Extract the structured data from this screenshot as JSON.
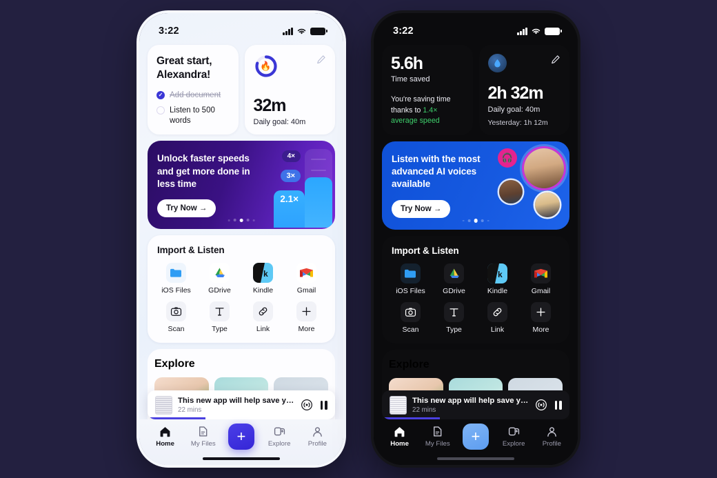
{
  "background_color": "#232040",
  "phones": [
    {
      "theme": "light",
      "status": {
        "time": "3:22",
        "signal_icon": "cellular-bars-icon",
        "wifi_icon": "wifi-icon",
        "battery_icon": "battery-icon"
      },
      "greeting": {
        "title": "Great start,\nAlexandra!",
        "todos": [
          {
            "label": "Add document",
            "done": true
          },
          {
            "label": "Listen to 500 words",
            "done": false
          }
        ]
      },
      "stats": {
        "edit_icon": "pencil-icon",
        "ring_percent": 80,
        "ring_color": "#3b37d6",
        "value": "32m",
        "sub": "Daily goal: 40m"
      },
      "promo": {
        "headline": "Unlock faster speeds and get more done in less time",
        "cta": "Try Now →",
        "dots": 5,
        "active_dot": 2,
        "chips": [
          "4×",
          "3×",
          "2.1×"
        ]
      },
      "import": {
        "title": "Import & Listen",
        "items": [
          {
            "label": "iOS Files",
            "icon": "ios-files-icon"
          },
          {
            "label": "GDrive",
            "icon": "google-drive-icon"
          },
          {
            "label": "Kindle",
            "icon": "kindle-icon"
          },
          {
            "label": "Gmail",
            "icon": "gmail-icon"
          },
          {
            "label": "Scan",
            "icon": "camera-icon"
          },
          {
            "label": "Type",
            "icon": "text-type-icon"
          },
          {
            "label": "Link",
            "icon": "link-icon"
          },
          {
            "label": "More",
            "icon": "plus-icon"
          }
        ]
      },
      "explore": {
        "title": "Explore"
      },
      "player": {
        "title": "This new app will help save yo...",
        "time": "22 mins",
        "cast_icon": "airplay-icon",
        "pause_icon": "pause-icon",
        "progress": 31
      },
      "nav": [
        {
          "label": "Home",
          "icon": "home-icon",
          "active": true
        },
        {
          "label": "My Files",
          "icon": "file-icon",
          "active": false
        },
        {
          "label": "",
          "icon": "plus-fab-icon",
          "active": false
        },
        {
          "label": "Explore",
          "icon": "explore-cards-icon",
          "active": false
        },
        {
          "label": "Profile",
          "icon": "person-icon",
          "active": false
        }
      ]
    },
    {
      "theme": "dark",
      "status": {
        "time": "3:22",
        "signal_icon": "cellular-bars-icon",
        "wifi_icon": "wifi-icon",
        "battery_icon": "battery-icon"
      },
      "time_saved": {
        "value": "5.6h",
        "label": "Time saved",
        "note_prefix": "You're saving time thanks to ",
        "note_highlight": "1.4× average speed"
      },
      "stats": {
        "edit_icon": "pencil-icon",
        "badge_icon": "droplet-icon",
        "value": "2h 32m",
        "sub": "Daily goal: 40m",
        "sub2": "Yesterday: 1h 12m"
      },
      "promo": {
        "headline": "Listen with the most advanced AI voices available",
        "cta": "Try Now →",
        "dots": 5,
        "active_dot": 2,
        "headphones_icon": "headphones-icon"
      },
      "import": {
        "title": "Import & Listen",
        "items": [
          {
            "label": "iOS Files",
            "icon": "ios-files-icon"
          },
          {
            "label": "GDrive",
            "icon": "google-drive-icon"
          },
          {
            "label": "Kindle",
            "icon": "kindle-icon"
          },
          {
            "label": "Gmail",
            "icon": "gmail-icon"
          },
          {
            "label": "Scan",
            "icon": "camera-icon"
          },
          {
            "label": "Type",
            "icon": "text-type-icon"
          },
          {
            "label": "Link",
            "icon": "link-icon"
          },
          {
            "label": "More",
            "icon": "plus-icon"
          }
        ]
      },
      "explore": {
        "title": "Explore"
      },
      "player": {
        "title": "This new app will help save yo...",
        "time": "22 mins",
        "cast_icon": "airplay-icon",
        "pause_icon": "pause-icon",
        "progress": 31
      },
      "nav": [
        {
          "label": "Home",
          "icon": "home-icon",
          "active": true
        },
        {
          "label": "My Files",
          "icon": "file-icon",
          "active": false
        },
        {
          "label": "",
          "icon": "plus-fab-icon",
          "active": false
        },
        {
          "label": "Explore",
          "icon": "explore-cards-icon",
          "active": false
        },
        {
          "label": "Profile",
          "icon": "person-icon",
          "active": false
        }
      ]
    }
  ]
}
